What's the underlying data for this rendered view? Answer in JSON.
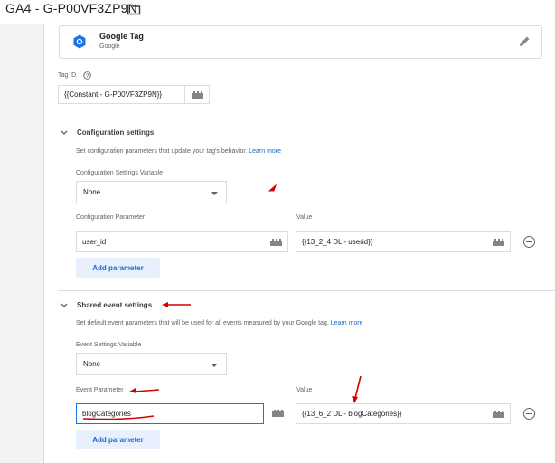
{
  "header": {
    "title": "GA4 - G-P00VF3ZP9N",
    "folder_icon": "folder-icon"
  },
  "tag_card": {
    "name": "Google Tag",
    "vendor": "Google",
    "icon": "google-tag-icon",
    "edit_icon": "pencil-icon"
  },
  "tag_id": {
    "label": "Tag ID",
    "value": "{{Constant - G-P00VF3ZP9N}}"
  },
  "config_settings": {
    "title": "Configuration settings",
    "description": "Set configuration parameters that update your tag's behavior.",
    "learn_more": "Learn more",
    "variable_label": "Configuration Settings Variable",
    "variable_value": "None",
    "param_label": "Configuration Parameter",
    "value_label": "Value",
    "param": "user_id",
    "value": "{{13_2_4 DL - userid}}",
    "add_label": "Add parameter"
  },
  "shared_settings": {
    "title": "Shared event settings",
    "description": "Set default event parameters that will be used for all events measured by your Google tag.",
    "learn_more": "Learn more",
    "variable_label": "Event Settings Variable",
    "variable_value": "None",
    "param_label": "Event Parameter",
    "value_label": "Value",
    "param": "blogCategories",
    "value": "{{13_6_2 DL - blogCategories}}",
    "add_label": "Add parameter"
  },
  "colors": {
    "accent": "#1967d2",
    "annotation": "#d50000",
    "button_bg": "#e8f0fe"
  }
}
